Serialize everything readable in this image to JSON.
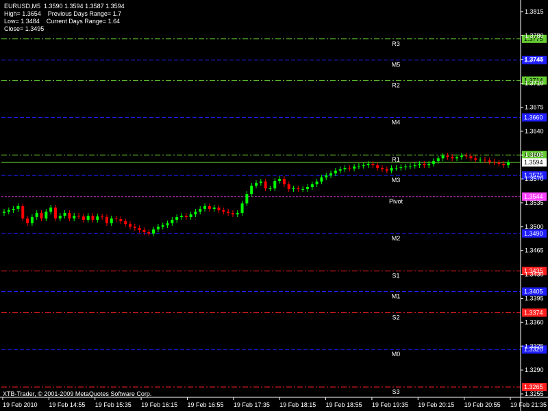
{
  "header": {
    "symbol_line": "EURUSD,M5  1.3590 1.3594 1.3587 1.3594",
    "high_line": "High= 1.3654    Previous Days Range= 1.7",
    "low_line": "Low= 1.3484    Current Days Range= 1.64",
    "close_line": "Close= 1.3495"
  },
  "footer": {
    "copyright": "XTB-Trader, © 2001-2009 MetaQuotes Software Corp."
  },
  "colors": {
    "background": "#000000",
    "bull": "#00ff00",
    "bear": "#ff0000",
    "resistance": "#66cc33",
    "mid": "#1f1fff",
    "support": "#ff2020",
    "pivot": "#ff44ff",
    "grid_text": "#ffffff",
    "current_price_line": "#66cc33"
  },
  "chart_data": {
    "type": "candlestick",
    "y_range": [
      1.325,
      1.383
    ],
    "y_ticks": [
      "1.3815",
      "1.3780",
      "1.3745",
      "1.3710",
      "1.3675",
      "1.3640",
      "1.3605",
      "1.3570",
      "1.3535",
      "1.3500",
      "1.3465",
      "1.3430",
      "1.3395",
      "1.3360",
      "1.3325",
      "1.3290",
      "1.3255"
    ],
    "x_labels": [
      "19 Feb 2010",
      "19 Feb 14:55",
      "19 Feb 15:35",
      "19 Feb 16:15",
      "19 Feb 16:55",
      "19 Feb 17:35",
      "19 Feb 18:15",
      "19 Feb 18:55",
      "19 Feb 19:35",
      "19 Feb 20:15",
      "19 Feb 20:55",
      "19 Feb 21:35"
    ],
    "current_price": {
      "label": "1.3594",
      "value": 1.3594
    },
    "levels": [
      {
        "name": "R3",
        "value": 1.3775,
        "label": "1.3775",
        "kind": "resistance"
      },
      {
        "name": "M5",
        "value": 1.3744,
        "label": "1.3744",
        "kind": "mid"
      },
      {
        "name": "R2",
        "value": 1.3714,
        "label": "1.3714",
        "kind": "resistance"
      },
      {
        "name": "M4",
        "value": 1.366,
        "label": "1.3660",
        "kind": "mid"
      },
      {
        "name": "R1",
        "value": 1.3605,
        "label": "1.3605",
        "kind": "resistance"
      },
      {
        "name": "M3",
        "value": 1.3575,
        "label": "1.3575",
        "kind": "mid"
      },
      {
        "name": "Pivot",
        "value": 1.3544,
        "label": "1.3544",
        "kind": "pivot"
      },
      {
        "name": "M2",
        "value": 1.349,
        "label": "1.3490",
        "kind": "mid"
      },
      {
        "name": "S1",
        "value": 1.3435,
        "label": "1.3435",
        "kind": "support"
      },
      {
        "name": "M1",
        "value": 1.3405,
        "label": "1.3405",
        "kind": "mid"
      },
      {
        "name": "S2",
        "value": 1.3374,
        "label": "1.3374",
        "kind": "support"
      },
      {
        "name": "M0",
        "value": 1.332,
        "label": "1.3320",
        "kind": "mid"
      },
      {
        "name": "S3",
        "value": 1.3265,
        "label": "1.3265",
        "kind": "support"
      }
    ],
    "closes": [
      1.3522,
      1.3524,
      1.3526,
      1.353,
      1.3512,
      1.3505,
      1.3514,
      1.352,
      1.3512,
      1.3522,
      1.3528,
      1.3512,
      1.3516,
      1.352,
      1.3512,
      1.3516,
      1.3515,
      1.351,
      1.3516,
      1.351,
      1.3515,
      1.3514,
      1.3505,
      1.3512,
      1.3511,
      1.3508,
      1.3504,
      1.35,
      1.3498,
      1.3495,
      1.3492,
      1.349,
      1.3496,
      1.35,
      1.3502,
      1.3505,
      1.351,
      1.3514,
      1.3516,
      1.3514,
      1.3518,
      1.3522,
      1.3526,
      1.353,
      1.3526,
      1.3528,
      1.3524,
      1.3522,
      1.352,
      1.3518,
      1.352,
      1.3534,
      1.3548,
      1.356,
      1.3564,
      1.3566,
      1.3556,
      1.3556,
      1.3567,
      1.357,
      1.3562,
      1.3555,
      1.3556,
      1.3555,
      1.3555,
      1.3558,
      1.3562,
      1.3566,
      1.3572,
      1.3575,
      1.3578,
      1.3582,
      1.3584,
      1.3586,
      1.3585,
      1.3588,
      1.3589,
      1.359,
      1.3592,
      1.359,
      1.3586,
      1.3584,
      1.3582,
      1.3586,
      1.3586,
      1.3587,
      1.3588,
      1.3589,
      1.359,
      1.3592,
      1.359,
      1.3592,
      1.3596,
      1.36,
      1.3604,
      1.3602,
      1.36,
      1.3602,
      1.3604,
      1.3603,
      1.36,
      1.3598,
      1.3598,
      1.3597,
      1.3595,
      1.3594,
      1.3592,
      1.359,
      1.3594
    ]
  }
}
